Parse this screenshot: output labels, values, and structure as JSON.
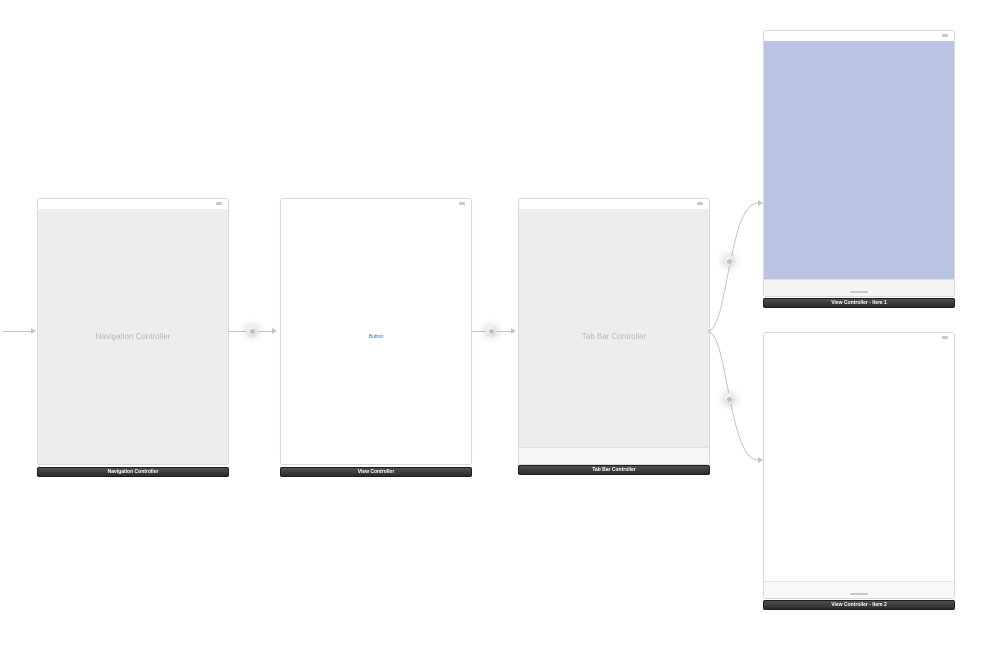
{
  "scenes": {
    "nav": {
      "caption": "Navigation Controller",
      "placeholder": "Navigation Controller"
    },
    "middle": {
      "caption": "View Controller",
      "button_label": "Button"
    },
    "tabbar": {
      "caption": "Tab Bar Controller",
      "placeholder": "Tab Bar Controller"
    },
    "item1": {
      "caption": "View Controller - Item 1"
    },
    "item2": {
      "caption": "View Controller - Item 2"
    }
  }
}
